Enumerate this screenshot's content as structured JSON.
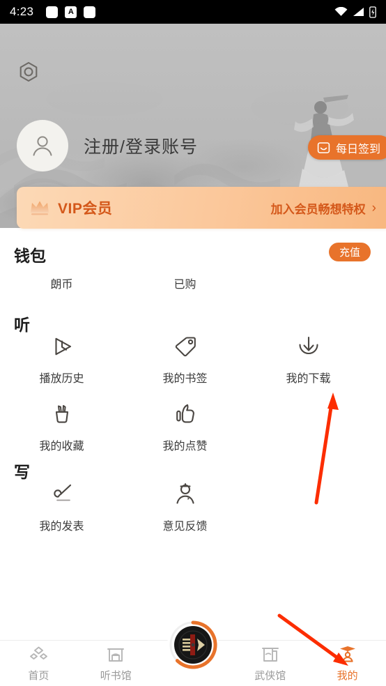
{
  "status_bar": {
    "time": "4:23",
    "left_icons": [
      "rounded-square-icon",
      "a-badge-icon",
      "rounded-square-icon"
    ],
    "right_icons": [
      "wifi-icon",
      "signal-icon",
      "battery-icon"
    ]
  },
  "header": {
    "settings_icon": "hexagon-nut-icon",
    "avatar_icon": "person-avatar-icon",
    "login_text": "注册/登录账号",
    "signin_button": {
      "label": "每日签到",
      "icon": "calendar-check-icon",
      "color": "#e8732b"
    }
  },
  "vip_banner": {
    "icon": "crown-icon",
    "title": "VIP会员",
    "action_text": "加入会员畅想特权",
    "chevron": "›",
    "text_color": "#d4581a",
    "bg_from": "#fcd9b6",
    "bg_to": "#f8b77f"
  },
  "wallet": {
    "title": "钱包",
    "recharge_label": "充值",
    "items": [
      {
        "label": "朗币"
      },
      {
        "label": "已购"
      }
    ]
  },
  "listen": {
    "title": "听",
    "items": [
      {
        "label": "播放历史",
        "icon": "play-history-icon"
      },
      {
        "label": "我的书签",
        "icon": "bookmark-tag-icon"
      },
      {
        "label": "我的下载",
        "icon": "download-icon"
      },
      {
        "label": "我的收藏",
        "icon": "brush-pot-favorite-icon"
      },
      {
        "label": "我的点赞",
        "icon": "thumbs-up-icon"
      }
    ]
  },
  "write": {
    "title": "写",
    "items": [
      {
        "label": "我的发表",
        "icon": "brush-pen-icon"
      },
      {
        "label": "意见反馈",
        "icon": "person-feedback-icon"
      }
    ]
  },
  "bottom_nav": {
    "active_color": "#e8732b",
    "inactive_color": "#9a9a9a",
    "items": [
      {
        "label": "首页",
        "icon": "home-diamonds-icon",
        "active": false
      },
      {
        "label": "听书馆",
        "icon": "library-house-icon",
        "active": false
      },
      {
        "label": "武侠馆",
        "icon": "pavilion-icon",
        "active": false
      },
      {
        "label": "我的",
        "icon": "person-hat-icon",
        "active": true
      }
    ],
    "player_button": {
      "icon": "vinyl-player-icon",
      "ring_color": "#e8732b"
    }
  },
  "annotations": {
    "arrow_color": "#fc2d00",
    "arrows": [
      {
        "name": "arrow-to-my-downloads"
      },
      {
        "name": "arrow-to-mine-tab"
      }
    ]
  }
}
